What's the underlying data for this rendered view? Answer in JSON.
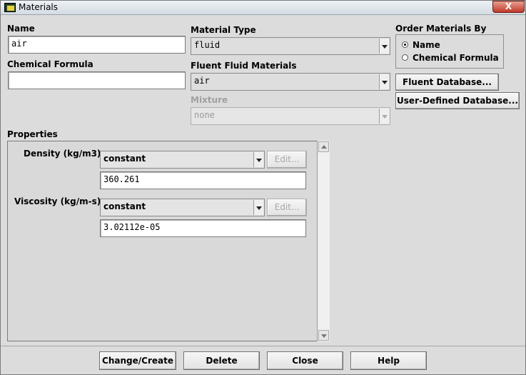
{
  "window": {
    "title": "Materials",
    "close_symbol": "X"
  },
  "name_field": {
    "label": "Name",
    "value": "air"
  },
  "chemical_formula_field": {
    "label": "Chemical Formula",
    "value": ""
  },
  "material_type": {
    "label": "Material Type",
    "selected": "fluid"
  },
  "fluent_fluid_materials": {
    "label": "Fluent Fluid Materials",
    "selected": "air"
  },
  "mixture": {
    "label": "Mixture",
    "selected": "none",
    "disabled": true
  },
  "order_by": {
    "label": "Order Materials By",
    "options": [
      {
        "label": "Name",
        "checked": true
      },
      {
        "label": "Chemical Formula",
        "checked": false
      }
    ]
  },
  "database_buttons": {
    "fluent": "Fluent Database...",
    "user_defined": "User-Defined Database..."
  },
  "properties": {
    "label": "Properties",
    "density": {
      "label": "Density (kg/m3)",
      "method": "constant",
      "edit_label": "Edit...",
      "value": "360.261"
    },
    "viscosity": {
      "label": "Viscosity (kg/m-s)",
      "method": "constant",
      "edit_label": "Edit...",
      "value": "3.02112e-05"
    }
  },
  "actions": {
    "change_create": "Change/Create",
    "delete": "Delete",
    "close": "Close",
    "help": "Help"
  },
  "icons": {
    "app": "fluent-app-icon",
    "close": "close-icon",
    "dropdown": "chevron-down-icon",
    "radio": "radio-icon"
  }
}
